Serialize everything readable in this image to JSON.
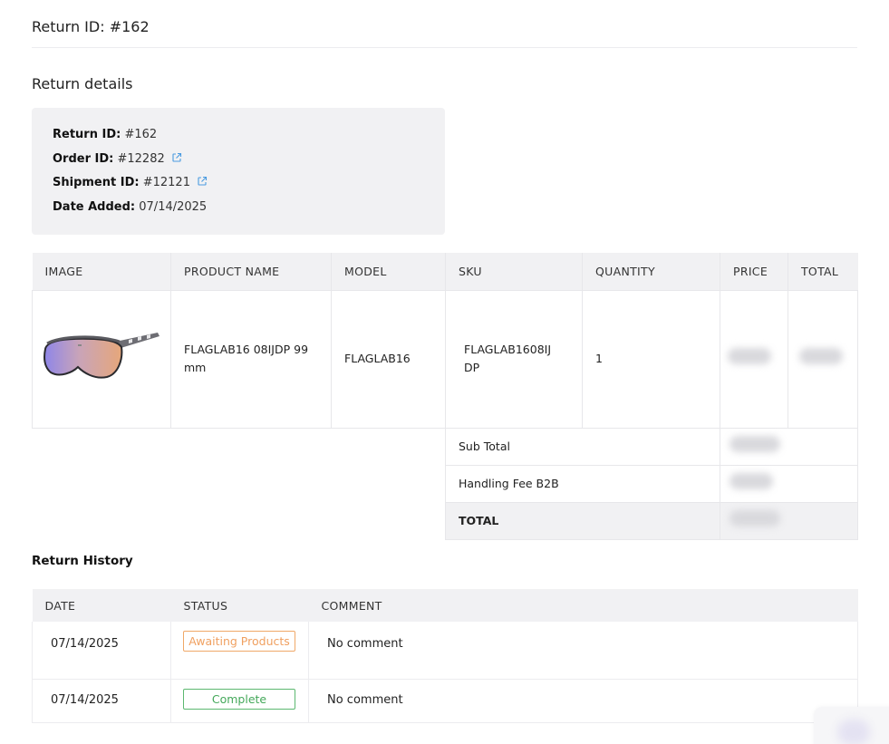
{
  "header": {
    "title": "Return ID: #162"
  },
  "details": {
    "section_title": "Return details",
    "return_id_label": "Return ID:",
    "return_id_value": "#162",
    "order_id_label": "Order ID:",
    "order_id_value": "#12282",
    "shipment_id_label": "Shipment ID:",
    "shipment_id_value": "#12121",
    "date_added_label": "Date Added:",
    "date_added_value": "07/14/2025"
  },
  "products": {
    "columns": [
      "IMAGE",
      "PRODUCT NAME",
      "MODEL",
      "SKU",
      "QUANTITY",
      "PRICE",
      "TOTAL"
    ],
    "items": [
      {
        "product_name": "FLAGLAB16 08IJDP 99 mm",
        "model": "FLAGLAB16",
        "sku": "FLAGLAB1608IJ DP",
        "quantity": "1"
      }
    ],
    "sub_total_label": "Sub Total",
    "handling_fee_label": "Handling Fee B2B",
    "total_label": "TOTAL"
  },
  "history": {
    "title": "Return History",
    "columns": [
      "DATE",
      "STATUS",
      "COMMENT"
    ],
    "rows": [
      {
        "date": "07/14/2025",
        "status": "Awaiting Products",
        "comment": "No comment"
      },
      {
        "date": "07/14/2025",
        "status": "Complete",
        "comment": "No comment"
      }
    ]
  },
  "colors": {
    "awaiting_status": "#f0a060",
    "complete_status": "#44a85a",
    "link_icon": "#4a9be0",
    "table_header_bg": "#f1f1f3"
  },
  "icons": {
    "external_link": "external-link-icon"
  }
}
